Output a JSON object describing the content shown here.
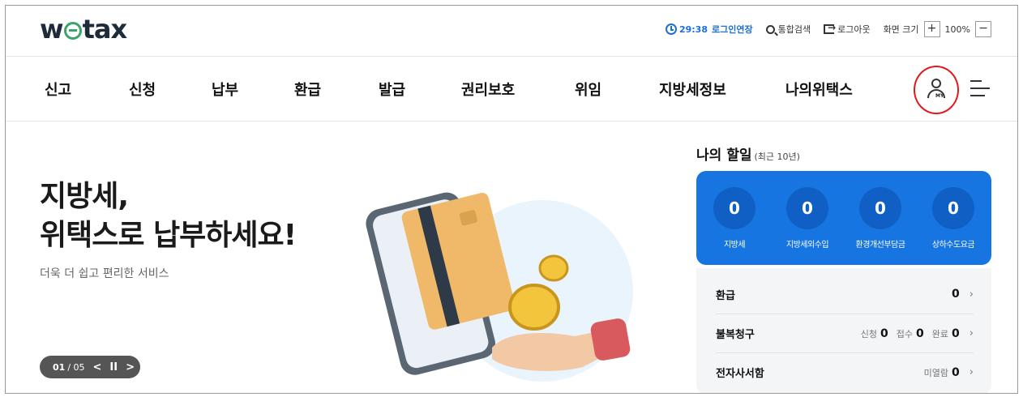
{
  "brand": {
    "logo_pre": "w",
    "logo_post": "tax"
  },
  "utility": {
    "timer": "29:38",
    "extend_label": "로그인연장",
    "search_label": "통합검색",
    "logout_label": "로그아웃",
    "zoom_label": "화면 크기",
    "zoom_in": "+",
    "zoom_value": "100%",
    "zoom_out": "−"
  },
  "nav": {
    "items": [
      "신고",
      "신청",
      "납부",
      "환급",
      "발급",
      "권리보호",
      "위임",
      "지방세정보",
      "나의위택스"
    ],
    "my_label": "MY"
  },
  "hero": {
    "title_line1": "지방세,",
    "title_line2": "위택스로 납부하세요!",
    "subtitle": "더욱 더 쉽고 편리한 서비스",
    "pager_current": "01",
    "pager_total": "/ 05",
    "prev": "<",
    "pause": "II",
    "next": ">"
  },
  "todo": {
    "title": "나의 할일",
    "period": "(최근 10년)",
    "stats": [
      {
        "value": "0",
        "label": "지방세"
      },
      {
        "value": "0",
        "label": "지방세외수입"
      },
      {
        "value": "0",
        "label": "환경개선부담금"
      },
      {
        "value": "0",
        "label": "상하수도요금"
      }
    ],
    "rows": {
      "refund": {
        "label": "환급",
        "value": "0"
      },
      "appeal": {
        "label": "불복청구",
        "applied_label": "신청",
        "applied": "0",
        "received_label": "접수",
        "received": "0",
        "done_label": "완료",
        "done": "0"
      },
      "mailbox": {
        "label": "전자사서함",
        "unread_label": "미열람",
        "unread": "0"
      }
    }
  },
  "colors": {
    "accent": "#1675e0",
    "accent_dark": "#0f5fc4",
    "highlight_circle": "#e01a1a",
    "logo_green": "#3aa56a"
  }
}
